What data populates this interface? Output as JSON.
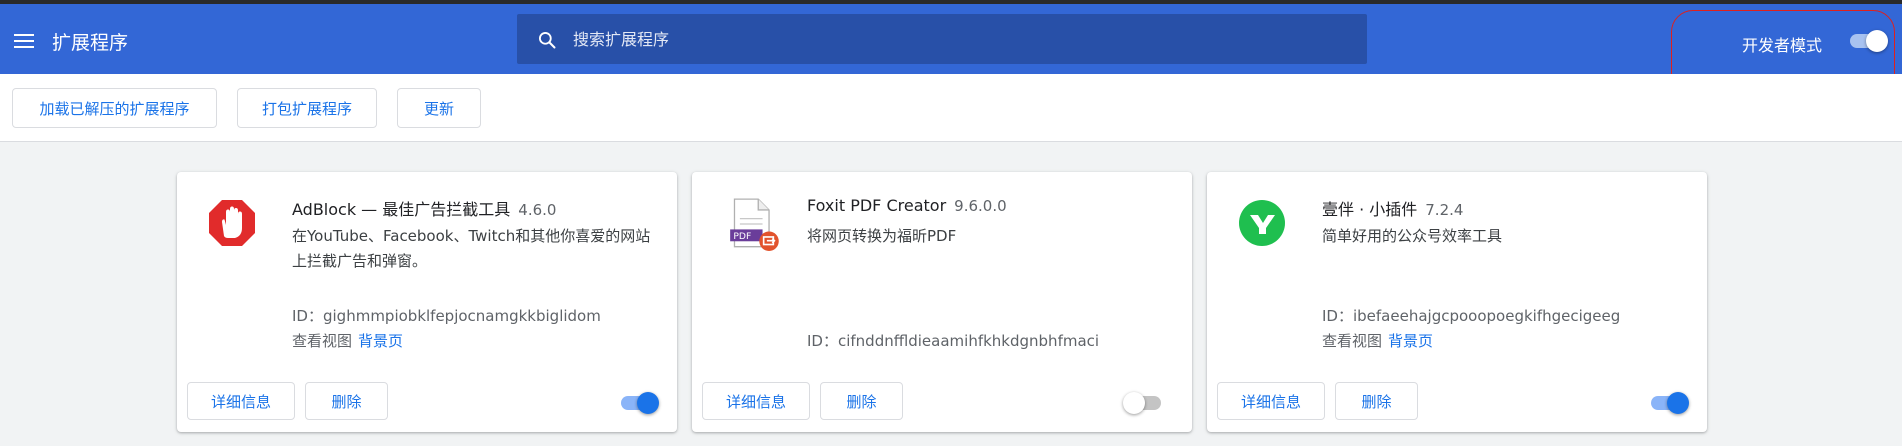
{
  "header": {
    "title": "扩展程序",
    "search_placeholder": "搜索扩展程序",
    "dev_mode_label": "开发者模式",
    "dev_mode_on": true,
    "accent_color": "#3367d6"
  },
  "toolbar": {
    "load_unpacked_label": "加载已解压的扩展程序",
    "pack_label": "打包扩展程序",
    "update_label": "更新"
  },
  "extensions": [
    {
      "name": "AdBlock — 最佳广告拦截工具",
      "version": "4.6.0",
      "description": "在YouTube、Facebook、Twitch和其他你喜爱的网站上拦截广告和弹窗。",
      "id_label": "ID：",
      "id": "gighmmpiobklfepjocnamgkkbiglidom",
      "views_label": "查看视图",
      "view_link": "背景页",
      "details_label": "详细信息",
      "remove_label": "删除",
      "enabled": true,
      "icon": "adblock-hand-icon"
    },
    {
      "name": "Foxit PDF Creator",
      "version": "9.6.0.0",
      "description": "将网页转换为福昕PDF",
      "id_label": "ID：",
      "id": "cifnddnffldieaamihfkhkdgnbhfmaci",
      "details_label": "详细信息",
      "remove_label": "删除",
      "enabled": false,
      "icon": "foxit-pdf-icon",
      "icon_text": "PDF"
    },
    {
      "name": "壹伴 · 小插件",
      "version": "7.2.4",
      "description": "简单好用的公众号效率工具",
      "id_label": "ID：",
      "id": "ibefaeehajgcpooopoegkifhgecigeeg",
      "views_label": "查看视图",
      "view_link": "背景页",
      "details_label": "详细信息",
      "remove_label": "删除",
      "enabled": true,
      "icon": "yiban-icon"
    }
  ]
}
